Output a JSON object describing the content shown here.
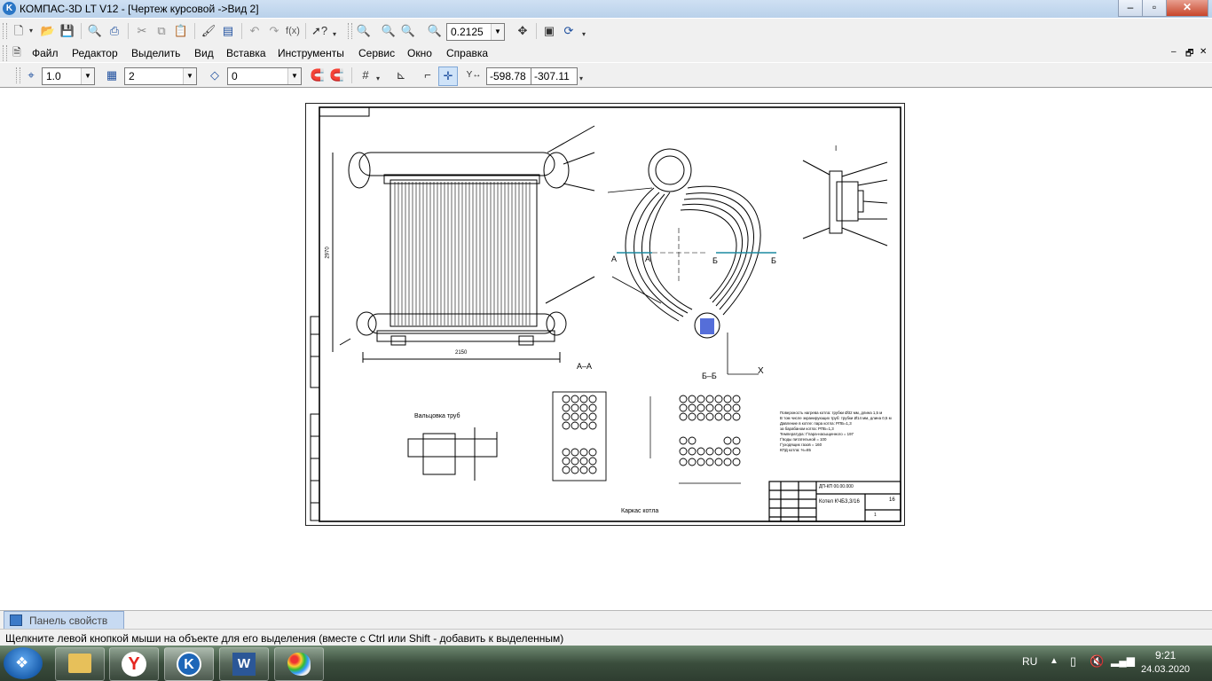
{
  "window": {
    "title": "КОМПАС-3D LT V12 - [Чертеж курсовой ->Вид 2]",
    "logo": "K"
  },
  "toolbar1": {
    "zoom_value": "0.2125"
  },
  "menu": {
    "items": [
      "Файл",
      "Редактор",
      "Выделить",
      "Вид",
      "Вставка",
      "Инструменты",
      "Сервис",
      "Окно",
      "Справка"
    ]
  },
  "toolbar2": {
    "step": "1.0",
    "layer": "2",
    "style": "0",
    "coord_x": "-598.78",
    "coord_y": "-307.11"
  },
  "drawing": {
    "section_aa": "А–А",
    "section_bb": "Б–Б",
    "mark_a": "А",
    "mark_b": "Б",
    "axis_x": "X",
    "view_i": "I",
    "caption_tubes": "Вальцовка труб",
    "caption_casing": "Каркас котла",
    "dim_width": "2150",
    "dim_height": "2970",
    "notes": [
      "Поверхность нагрева котла: трубки Ø32 мм, длина 1,5 м",
      "В том числе экранирующих труб: трубки Ø14 мм, длина 0,5 м",
      "Давление в котле: пара котла: РПБ=1,3",
      "за барабаном котла: РПБ=1,3",
      "Температура: t°пара-насыщенного = 197",
      "t°воды питательной = 100",
      "t°уходящих газов = 160",
      "КПД котла: %=85"
    ],
    "stamp_title": "Котел КЧБ3,3/16",
    "stamp_sheet": "1",
    "stamp_code": "ДП-КП 00.00.000",
    "stamp_sheets": "16"
  },
  "panel": {
    "tab_label": "Панель свойств"
  },
  "status": {
    "text": "Щелкните левой кнопкой мыши на объекте для его выделения (вместе с Ctrl или Shift - добавить к выделенным)"
  },
  "taskbar": {
    "lang": "RU",
    "time": "9:21",
    "date": "24.03.2020"
  }
}
